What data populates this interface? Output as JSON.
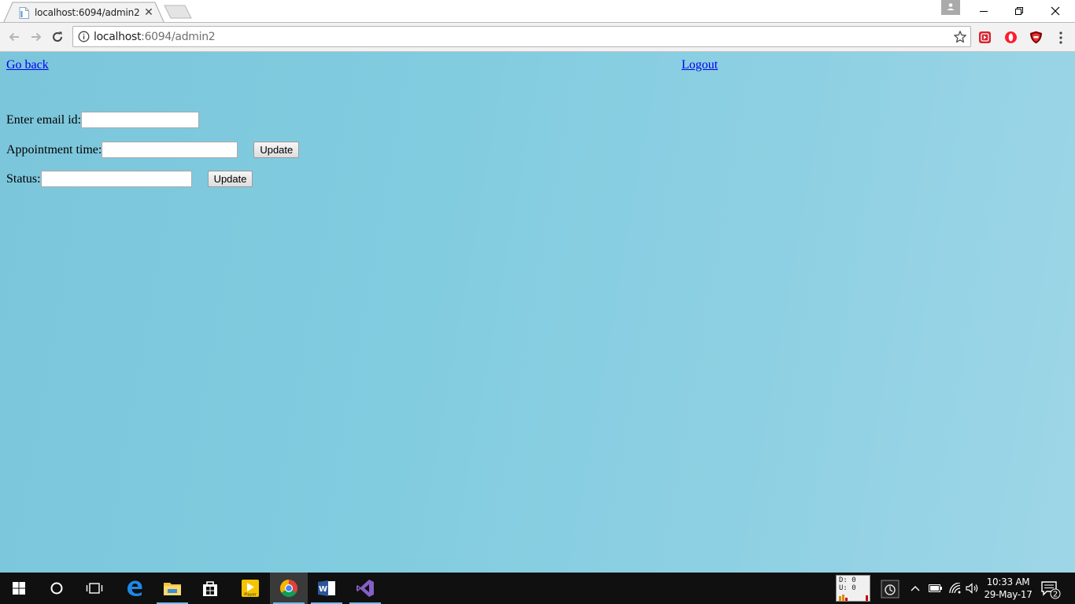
{
  "browser": {
    "tab_title": "localhost:6094/admin2",
    "url_host": "localhost",
    "url_rest": ":6094/admin2"
  },
  "page": {
    "go_back_label": "Go back",
    "logout_label": "Logout",
    "email_label": "Enter email id:",
    "email_value": "",
    "appointment_label": "Appointment time:",
    "appointment_value": "",
    "appointment_update_label": "Update",
    "status_label": "Status:",
    "status_value": "",
    "status_update_label": "Update"
  },
  "taskbar": {
    "netmeter_down": "D: 0",
    "netmeter_up": "U: 0",
    "clock_time": "10:33 AM",
    "clock_date": "29-May-17",
    "notification_count": "2",
    "player_label": "Player"
  },
  "colors": {
    "page_background": "#7ec8dd",
    "link": "#0000ee",
    "taskbar": "#101010"
  }
}
